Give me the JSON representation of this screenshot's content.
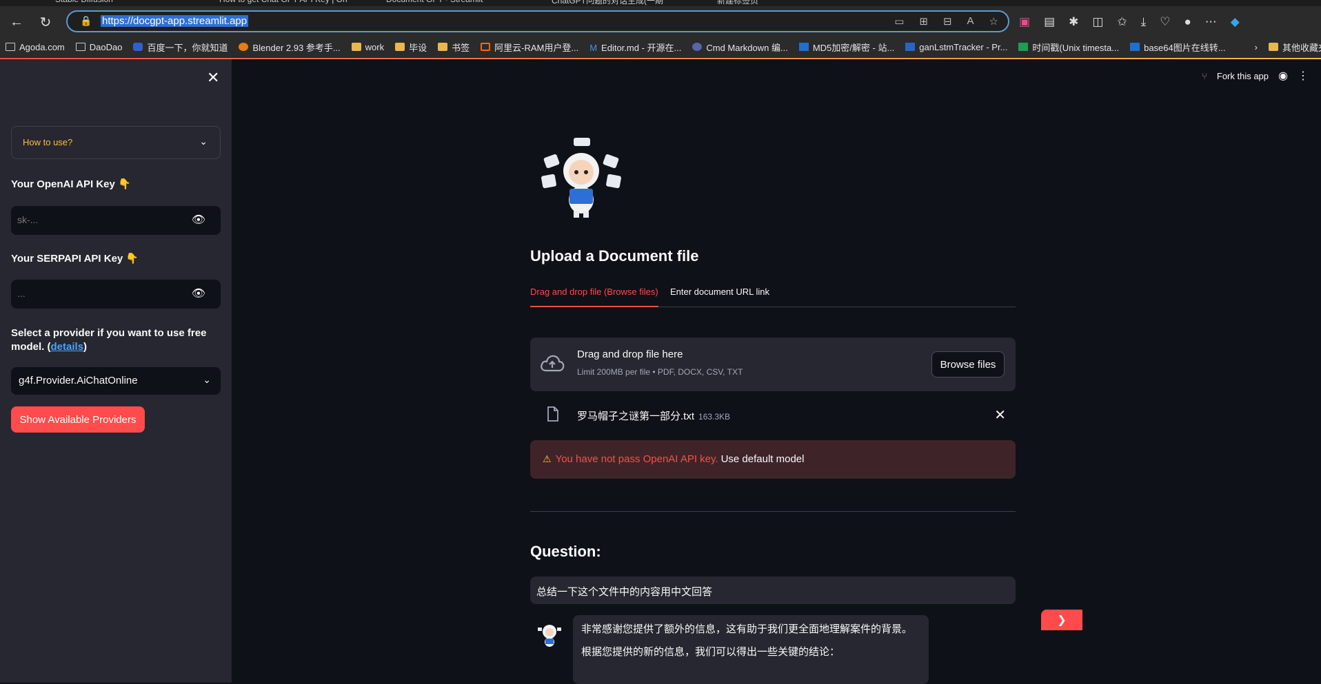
{
  "browser": {
    "tabs": [
      "Stable Diffusion",
      "How to get Chat GPT API Key | On",
      "Document GPT · Streamlit",
      "ChatGPT问题的对话生成(一期",
      "新建标签页"
    ],
    "url": "https://docgpt-app.streamlit.app",
    "bookmarks": [
      "Agoda.com",
      "DaoDao",
      "百度一下，你就知道",
      "Blender 2.93 参考手...",
      "work",
      "毕设",
      "书签",
      "阿里云-RAM用户登...",
      "Editor.md - 开源在...",
      "Cmd Markdown 编...",
      "MD5加密/解密 - 站...",
      "ganLstmTracker - Pr...",
      "时间戳(Unix timesta...",
      "base64图片在线转..."
    ],
    "other_bookmarks": "其他收藏夹"
  },
  "sidebar": {
    "expander_label": "How to use?",
    "openai_label": "Your OpenAI API Key 👇",
    "openai_placeholder": "sk-...",
    "serpapi_label": "Your SERPAPI API Key 👇",
    "serpapi_placeholder": "...",
    "provider_text_1": "Select a provider if you want to use free model. (",
    "provider_link": "details",
    "provider_text_2": ")",
    "provider_value": "g4f.Provider.AiChatOnline",
    "show_button": "Show Available Providers"
  },
  "header": {
    "fork_label": "Fork this app"
  },
  "main": {
    "upload_title": "Upload a Document file",
    "tab_drag": "Drag and drop file (Browse files)",
    "tab_url": "Enter document URL link",
    "dz_title": "Drag and drop file here",
    "dz_sub": "Limit 200MB per file • PDF, DOCX, CSV, TXT",
    "browse_label": "Browse files",
    "file_name": "罗马帽子之谜第一部分.txt",
    "file_size": "163.3KB",
    "warn_red": "You have not pass OpenAI API key.",
    "warn_rest": "Use default model",
    "question_title": "Question:",
    "question_value": "总结一下这个文件中的内容用中文回答",
    "answer_p1": "非常感谢您提供了额外的信息，这有助于我们更全面地理解案件的背景。",
    "answer_p2": "根据您提供的新的信息，我们可以得出一些关键的结论："
  },
  "colors": {
    "accent": "#ff4b4b",
    "warning": "#ffbd45",
    "link": "#4aa3ff",
    "background": "#0e1117",
    "sidebar": "#262730"
  }
}
